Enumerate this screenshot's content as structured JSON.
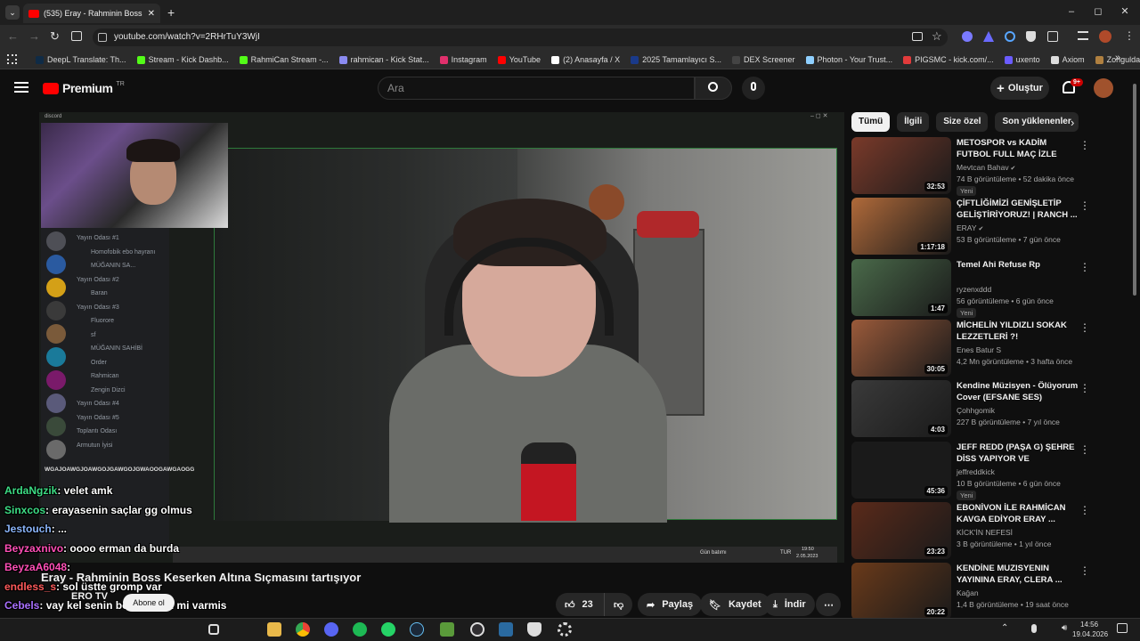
{
  "browser": {
    "tab_title": "(535) Eray - Rahminin Boss Keser",
    "url": "youtube.com/watch?v=2RHrTuY3WjI",
    "window_controls": {
      "minimize": "–",
      "maximize": "◻",
      "close": "✕"
    },
    "bookmarks": [
      {
        "label": "DeepL Translate: Th...",
        "color": "#0f2b46"
      },
      {
        "label": "Stream - Kick Dashb...",
        "color": "#53fc18"
      },
      {
        "label": "RahmiCan Stream -...",
        "color": "#53fc18"
      },
      {
        "label": "rahmican - Kick Stat...",
        "color": "#8a8af0"
      },
      {
        "label": "Instagram",
        "color": "#e1306c"
      },
      {
        "label": "YouTube",
        "color": "#ff0000"
      },
      {
        "label": "(2) Anasayfa / X",
        "color": "#ffffff"
      },
      {
        "label": "2025 Tamamlayıcı S...",
        "color": "#1a3a8a"
      },
      {
        "label": "DEX Screener",
        "color": "#444444"
      },
      {
        "label": "Photon - Your Trust...",
        "color": "#8fd0ff"
      },
      {
        "label": "PIGSMC - kick.com/...",
        "color": "#e23b3b"
      },
      {
        "label": "uxento",
        "color": "#6b5cff"
      },
      {
        "label": "Axiom",
        "color": "#dddddd"
      },
      {
        "label": "Zonguldak İngilizce...",
        "color": "#b08040"
      }
    ]
  },
  "youtube": {
    "logo_text": "Premium",
    "logo_sup": "TR",
    "search_placeholder": "Ara",
    "create_label": "Oluştur",
    "notif_badge": "9+",
    "video_title": "Eray - Rahminin Boss Keserken Altına Sıçmasını tartışıyor",
    "channel": "ERO TV",
    "subscribe_label": "Abone ol",
    "like_count": "23",
    "share_label": "Paylaş",
    "save_label": "Kaydet",
    "download_label": "İndir",
    "chips": [
      "Tümü",
      "İlgili",
      "Size özel",
      "Son yüklenenler"
    ]
  },
  "video_overlay": {
    "discord_label": "discord",
    "channels": [
      "Yayın Odası #1",
      "Homofobik ebo hayranı",
      "MÜĞANIN SA...",
      "Yayın Odası #2",
      "Baran",
      "Yayın Odası #3",
      "Fluorore",
      "sf",
      "MÜĞANIN SAHİBİ",
      "Order",
      "Rahmican",
      "Zengin Dizci",
      "Yayın Odası #4",
      "Yayın Odası #5",
      "Toplantı Odası",
      "Armutun İyisi"
    ],
    "taskbar_weather": "Gün batımı",
    "taskbar_lang": "TUR",
    "taskbar_time": "19:50",
    "taskbar_date": "2.05.2023",
    "chat": [
      {
        "user": "ArdaNgzik",
        "color": "#3ddc84",
        "msg": ": velet amk"
      },
      {
        "user": "Sinxcos",
        "color": "#3ddc84",
        "msg": ": erayasenin saçlar gg olmus"
      },
      {
        "user": "Jestouch",
        "color": "#8ab4f8",
        "msg": ": ..."
      },
      {
        "user": "Beyzaxnivo",
        "color": "#ff4fb6",
        "msg": ": oooo erman da burda"
      },
      {
        "user": "BeyzaA6048",
        "color": "#ff4fb6",
        "msg": ":"
      },
      {
        "user": "endless_s",
        "color": "#ff5a5a",
        "msg": ": sol üstte gromp var"
      },
      {
        "user": "Cebels",
        "color": "#a970ff",
        "msg": ": vay kel senin boyle sacin mi varmis"
      },
      {
        "user": "PassiveBT",
        "color": "#ff5a5a",
        "msg": ": olursun olursun"
      }
    ],
    "spam_line": "WGAJOAWGJOAWGOJGAWGOJGWAOOGAWGAOGG"
  },
  "recommendations": [
    {
      "title": "METOSPOR vs KADİM FUTBOL FULL MAÇ İZLE",
      "channel": "Mevtcan Bahav",
      "verified": true,
      "meta": "74 B görüntüleme • 52 dakika önce",
      "badge": "Yeni",
      "duration": "32:53",
      "thumb": "#7a3a2a"
    },
    {
      "title": "ÇİFTLİĞİMİZİ GENİŞLETİP GELİŞTİRİYORUZ! | RANCH ...",
      "channel": "ERAY",
      "verified": true,
      "meta": "53 B görüntüleme • 7 gün önce",
      "badge": "",
      "duration": "1:17:18",
      "thumb": "#b06a3a"
    },
    {
      "title": "Temel Ahi Refuse Rp",
      "channel": "ryzenxddd",
      "verified": false,
      "meta": "56 görüntüleme • 6 gün önce",
      "badge": "Yeni",
      "duration": "1:47",
      "thumb": "#4a6a4a"
    },
    {
      "title": "MİCHELİN YILDIZLI SOKAK LEZZETLERİ ?!",
      "channel": "Enes Batur S",
      "verified": false,
      "meta": "4,2 Mn görüntüleme • 3 hafta önce",
      "badge": "",
      "duration": "30:05",
      "thumb": "#9a5a3a"
    },
    {
      "title": "Kendine Müzisyen - Ölüyorum Cover (EFSANE SES)",
      "channel": "Çohhgomik",
      "verified": false,
      "meta": "227 B görüntüleme • 7 yıl önce",
      "badge": "",
      "duration": "4:03",
      "thumb": "#3a3a3a"
    },
    {
      "title": "JEFF REDD (PAŞA G) ŞEHRE DİSS YAPIYOR VE YAYINLIYOR...",
      "channel": "jeffreddkick",
      "verified": false,
      "meta": "10 B görüntüleme • 6 gün önce",
      "badge": "Yeni",
      "duration": "45:36",
      "thumb": "#1a1a1a"
    },
    {
      "title": "EBONİVON İLE RAHMİCAN KAVGA EDİYOR ERAY ...",
      "channel": "KİCK'İN NEFESİ",
      "verified": false,
      "meta": "3 B görüntüleme • 1 yıl önce",
      "badge": "",
      "duration": "23:23",
      "thumb": "#5a2a1a"
    },
    {
      "title": "KENDİNE MUZISYENIN YAYININA ERAY, CLERA ...",
      "channel": "Kağan",
      "verified": false,
      "meta": "1,4 B görüntüleme • 19 saat önce",
      "badge": "",
      "duration": "20:22",
      "thumb": "#6a3a1a"
    }
  ],
  "taskbar": {
    "time": "14:56",
    "date": "19.04.2026"
  }
}
